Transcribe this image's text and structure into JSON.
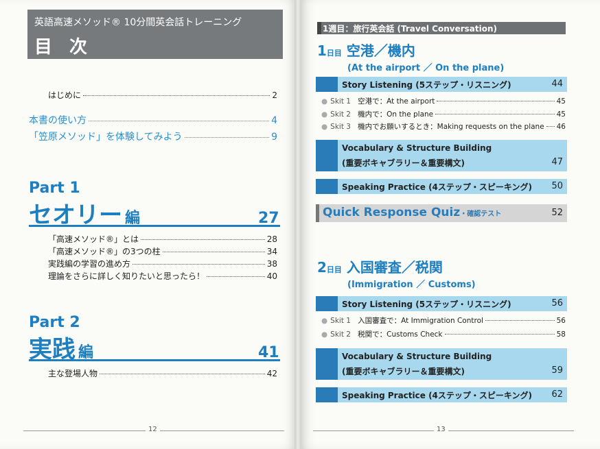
{
  "left": {
    "header_sub": "英語高速メソッド® 10分間英会話トレーニング",
    "header_title": "目 次",
    "entries": [
      {
        "title": "はじめに",
        "page": "2"
      },
      {
        "title": "本書の使い方",
        "page": "4"
      },
      {
        "title": "「笠原メソッド」を体験してみよう",
        "page": "9"
      }
    ],
    "part1": {
      "label": "Part 1",
      "title": "セオリー",
      "hen": "編",
      "page": "27",
      "items": [
        {
          "title": "「高速メソッド®」とは",
          "page": "28"
        },
        {
          "title": "「高速メソッド®」の3つの柱",
          "page": "34"
        },
        {
          "title": "実践編の学習の進め方",
          "page": "38"
        },
        {
          "title": "理論をさらに詳しく知りたいと思ったら！",
          "page": "40"
        }
      ]
    },
    "part2": {
      "label": "Part 2",
      "title": "実践",
      "hen": "編",
      "page": "41",
      "items": [
        {
          "title": "主な登場人物",
          "page": "42"
        }
      ]
    },
    "page_number": "12"
  },
  "right": {
    "week_header": "1週目：旅行英会話 (Travel Conversation)",
    "day1": {
      "num": "1",
      "day": "日目",
      "title": "空港／機内",
      "subtitle": "(At the airport ／ On the plane)",
      "story": {
        "label": "Story Listening (5ステップ・リスニング)",
        "page": "44"
      },
      "skits": [
        {
          "skit": "Skit 1",
          "title": "空港で：At the airport",
          "page": "45"
        },
        {
          "skit": "Skit 2",
          "title": "機内で：On the plane",
          "page": "45"
        },
        {
          "skit": "Skit 3",
          "title": "機内でお願いするとき：Making requests on the plane",
          "page": "46"
        }
      ],
      "vocab": {
        "label1": "Vocabulary & Structure Building",
        "label2": "(重要ボキャブラリー＆重要構文)",
        "page": "47"
      },
      "speaking": {
        "label": "Speaking Practice (4ステップ・スピーキング)",
        "page": "50"
      }
    },
    "quiz": {
      "label": "Quick Response Quiz",
      "label_small": "・確認テスト",
      "page": "52"
    },
    "day2": {
      "num": "2",
      "day": "日目",
      "title": "入国審査／税関",
      "subtitle": "(Immigration ／ Customs)",
      "story": {
        "label": "Story Listening (5ステップ・リスニング)",
        "page": "56"
      },
      "skits": [
        {
          "skit": "Skit 1",
          "title": "入国審査で：At Immigration Control",
          "page": "56"
        },
        {
          "skit": "Skit 2",
          "title": "税関で：Customs Check",
          "page": "58"
        }
      ],
      "vocab": {
        "label1": "Vocabulary & Structure Building",
        "label2": "(重要ボキャブラリー＆重要構文)",
        "page": "59"
      },
      "speaking": {
        "label": "Speaking Practice (4ステップ・スピーキング)",
        "page": "62"
      }
    },
    "page_number": "13"
  }
}
